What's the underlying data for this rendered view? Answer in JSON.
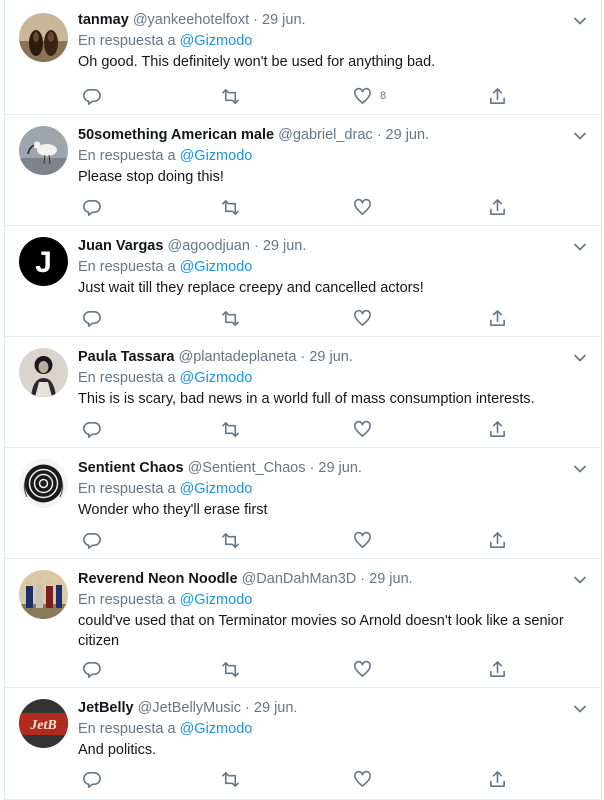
{
  "reply_prefix": "En respuesta a",
  "tweets": [
    {
      "name": "tanmay",
      "handle": "@yankeehotelfoxt",
      "date": "29 jun.",
      "reply_to": "@Gizmodo",
      "text": "Oh good. This definitely won't be used for anything bad.",
      "likes": "8",
      "avatar": "shoes"
    },
    {
      "name": "50something American male",
      "handle": "@gabriel_drac",
      "date": "29 jun.",
      "reply_to": "@Gizmodo",
      "text": "Please stop doing this!",
      "likes": "",
      "avatar": "bird"
    },
    {
      "name": "Juan Vargas",
      "handle": "@agoodjuan",
      "date": "29 jun.",
      "reply_to": "@Gizmodo",
      "text": "Just wait till they replace creepy and cancelled actors!",
      "likes": "",
      "avatar": "letter-j"
    },
    {
      "name": "Paula Tassara",
      "handle": "@plantadeplaneta",
      "date": "29 jun.",
      "reply_to": "@Gizmodo",
      "text": "This is is scary, bad news in a world full of mass consumption interests.",
      "likes": "",
      "avatar": "portrait"
    },
    {
      "name": "Sentient Chaos",
      "handle": "@Sentient_Chaos",
      "date": "29 jun.",
      "reply_to": "@Gizmodo",
      "text": "Wonder who they'll erase first",
      "likes": "",
      "avatar": "spiral"
    },
    {
      "name": "Reverend Neon Noodle",
      "handle": "@DanDahMan3D",
      "date": "29 jun.",
      "reply_to": "@Gizmodo",
      "text": "could've used that on Terminator movies so Arnold doesn't look like a senior citizen",
      "likes": "",
      "avatar": "group"
    },
    {
      "name": "JetBelly",
      "handle": "@JetBellyMusic",
      "date": "29 jun.",
      "reply_to": "@Gizmodo",
      "text": "And politics.",
      "likes": "",
      "avatar": "jetbelly-logo"
    }
  ]
}
